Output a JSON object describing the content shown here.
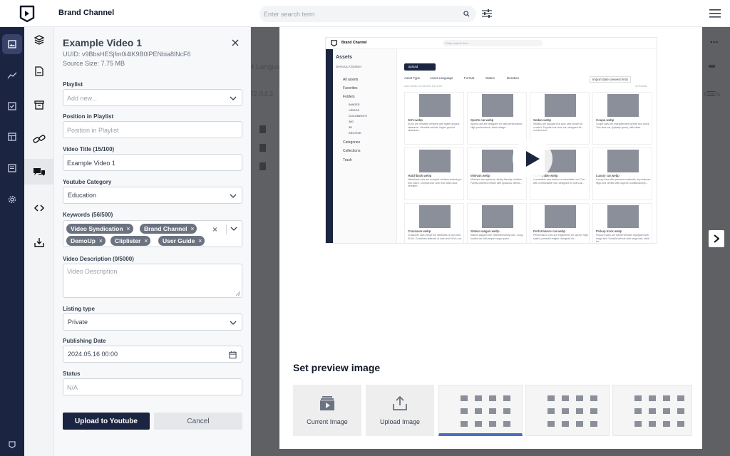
{
  "header": {
    "brand": "Brand Channel",
    "search_placeholder": "Enter search term"
  },
  "panel": {
    "title": "Example Video 1",
    "uuid": "UUID: v9BbsHESjfm0i4lK9B0lPENbia8lNcF6",
    "source_size": "Source Size: 7.75 MB",
    "playlist": {
      "label": "Playlist",
      "placeholder": "Add new..."
    },
    "position": {
      "label": "Position in Playlist",
      "placeholder": "Position in Playlist"
    },
    "video_title": {
      "label": "Video Title (15/100)",
      "value": "Example Video 1"
    },
    "category": {
      "label": "Youtube Category",
      "value": "Education"
    },
    "keywords": {
      "label": "Keywords (56/500)",
      "chips": [
        "Video Syndication",
        "Brand Channel",
        "DemoUp",
        "Cliplister",
        "User Guide"
      ]
    },
    "description": {
      "label": "Video Description (0/5000)",
      "placeholder": "Video Description"
    },
    "listing": {
      "label": "Listing type",
      "value": "Private"
    },
    "publishing": {
      "label": "Publishing Date",
      "value": "2024.05.16 00:00"
    },
    "status": {
      "label": "Status",
      "placeholder": "N/A"
    },
    "upload_label": "Upload to Youtube",
    "cancel_label": "Cancel"
  },
  "backdrop": {
    "language_text": "et Langua",
    "date_text": "22.04.2",
    "details_text": "etails"
  },
  "video": {
    "brand": "Brand Channel",
    "search": "Enter search term",
    "assets_title": "Assets",
    "client": "DemoUp Cliplister",
    "upload": "Upload",
    "filters": [
      "Asset Type",
      "Asset Language",
      "Format",
      "Status",
      "Duration"
    ],
    "sort": "Import date (newest first)",
    "last_refresh": "Last refresh: 22.05.2024 18:16:30",
    "results": "16 Results",
    "sidebar_items": [
      "All assets",
      "Favorites",
      "Folders",
      "IMAGES",
      "VIDEOS",
      "DOCUMENTS",
      "360",
      "3D",
      "ARCHIVE",
      "Categories",
      "Collections",
      "Trash"
    ],
    "cards": [
      {
        "name": "SUV.webp",
        "desc": "SUVs are versatile vehicles with higher ground clearance. Versatile vehicle, higher ground clearance..."
      },
      {
        "name": "Sports car.webp",
        "desc": "Sports cars are designed for high performance. High performance, sleek design..."
      },
      {
        "name": "Sedan.webp",
        "desc": "Sedans are popular four-door cars known for comfort. Popular four-door car, designed for comfort and..."
      },
      {
        "name": "Coupe.webp",
        "desc": "Coupe cars are characterized by their two doors. Two-door car, typically sporty, with sleek..."
      },
      {
        "name": "Hatchback.webp",
        "desc": "Hatchback cars are compact vehicles featuring a rear hatch. Compact car with rear hatch door, versatile..."
      },
      {
        "name": "Minivan.webp",
        "desc": "Minivans are spacious, family-friendly vehicles. Family-oriented vehicle with spacious interior..."
      },
      {
        "name": "Convertible.webp",
        "desc": "Convertible cars feature a retractable roof. Car with a retractable roof, designed for open-air..."
      },
      {
        "name": "Luxury car.webp",
        "desc": "Luxury cars offer premium materials, top features. High-end vehicle with superior craftsmanship..."
      },
      {
        "name": "Crossover.webp",
        "desc": "Crossover cars merge the attributes of cars and SUVs. Combines features of cars and SUVs, ver..."
      },
      {
        "name": "Station wagon.webp",
        "desc": "Station wagons are extended family cars. Long-bodied car with ample cargo space..."
      },
      {
        "name": "Performance car.webp",
        "desc": "Performance cars are engineered for speed. High speed, powerful engine, designed for..."
      },
      {
        "name": "Pickup truck.webp",
        "desc": "Pickup trucks are robust vehicles equipped with cargo bed. Durable vehicle with cargo bed, ideal for..."
      }
    ]
  },
  "preview": {
    "title": "Set preview image",
    "current_label": "Current Image",
    "upload_label": "Upload Image"
  },
  "colors": {
    "navy": "#1b2440",
    "backdrop": "#5f6063",
    "chip": "#6b7280"
  }
}
